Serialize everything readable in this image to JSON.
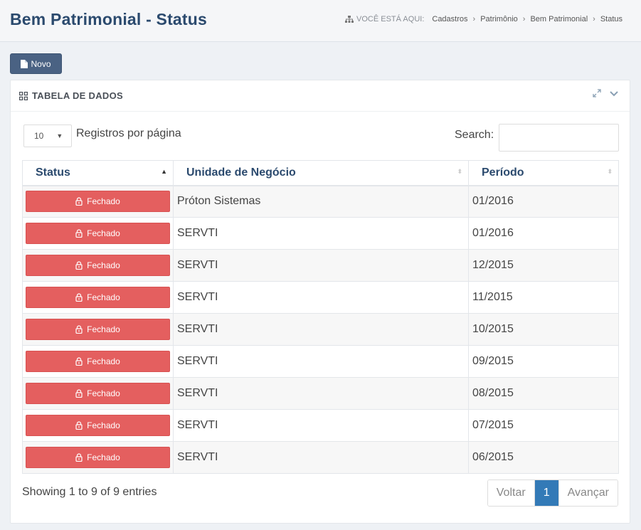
{
  "header": {
    "title": "Bem Patrimonial - Status",
    "here_label": "VOCÊ ESTÁ AQUI:",
    "breadcrumb": [
      "Cadastros",
      "Patrimônio",
      "Bem Patrimonial",
      "Status"
    ]
  },
  "toolbar": {
    "new_label": "Novo"
  },
  "panel": {
    "title": "TABELA DE DADOS"
  },
  "controls": {
    "length_value": "10",
    "length_label": "Registros por página",
    "search_label": "Search:",
    "search_value": ""
  },
  "table": {
    "headers": [
      "Status",
      "Unidade de Negócio",
      "Período"
    ],
    "rows": [
      {
        "status": "Fechado",
        "unit": "Próton Sistemas",
        "period": "01/2016"
      },
      {
        "status": "Fechado",
        "unit": "SERVTI",
        "period": "01/2016"
      },
      {
        "status": "Fechado",
        "unit": "SERVTI",
        "period": "12/2015"
      },
      {
        "status": "Fechado",
        "unit": "SERVTI",
        "period": "11/2015"
      },
      {
        "status": "Fechado",
        "unit": "SERVTI",
        "period": "10/2015"
      },
      {
        "status": "Fechado",
        "unit": "SERVTI",
        "period": "09/2015"
      },
      {
        "status": "Fechado",
        "unit": "SERVTI",
        "period": "08/2015"
      },
      {
        "status": "Fechado",
        "unit": "SERVTI",
        "period": "07/2015"
      },
      {
        "status": "Fechado",
        "unit": "SERVTI",
        "period": "06/2015"
      }
    ]
  },
  "footer": {
    "info": "Showing 1 to 9 of 9 entries",
    "prev_label": "Voltar",
    "current_page": "1",
    "next_label": "Avançar"
  },
  "colors": {
    "title": "#2b4a6e",
    "status_closed": "#e45f5f",
    "page_active": "#337ab7",
    "new_button": "#4a6283"
  },
  "icons": {
    "breadcrumb": "sitemap-icon",
    "new": "file-icon",
    "panel": "grid-icon",
    "expand": "expand-icon",
    "collapse": "chevron-down-icon",
    "status": "lock-icon",
    "sort": "sort-icon"
  }
}
